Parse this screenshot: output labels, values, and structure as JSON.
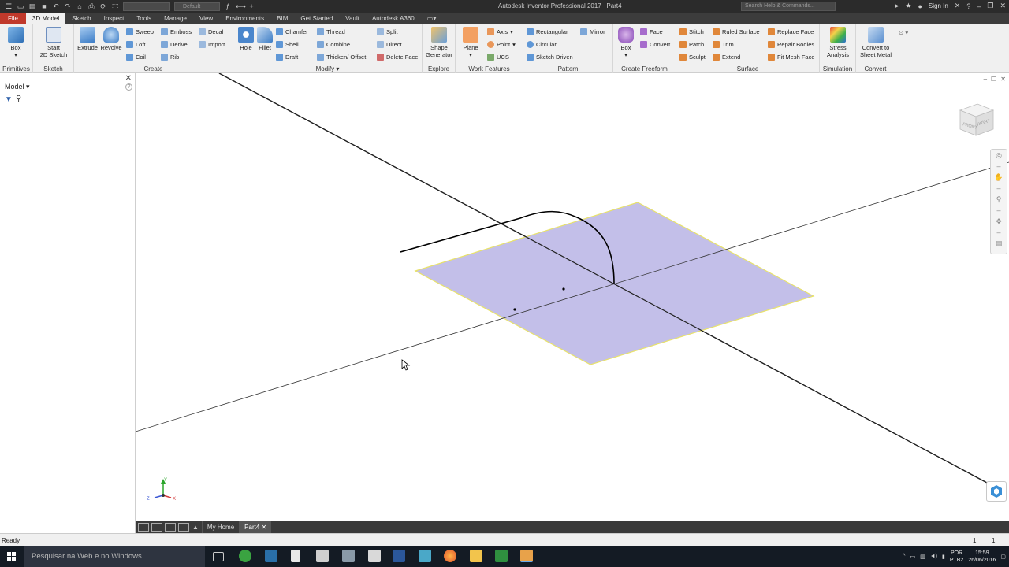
{
  "titlebar": {
    "title": "Autodesk Inventor Professional 2017",
    "doc": "Part4",
    "search_placeholder": "Search Help & Commands...",
    "sign_in": "Sign In",
    "appearance_value": "Default"
  },
  "tabs": [
    "File",
    "3D Model",
    "Sketch",
    "Inspect",
    "Tools",
    "Manage",
    "View",
    "Environments",
    "BIM",
    "Get Started",
    "Vault",
    "Autodesk A360"
  ],
  "ribbon": {
    "primitives": {
      "label": "Primitives",
      "box": "Box"
    },
    "sketch": {
      "label": "Sketch",
      "start": "Start",
      "start2": "2D Sketch"
    },
    "create": {
      "label": "Create",
      "extrude": "Extrude",
      "revolve": "Revolve",
      "sweep": "Sweep",
      "loft": "Loft",
      "coil": "Coil",
      "emboss": "Emboss",
      "derive": "Derive",
      "rib": "Rib",
      "decal": "Decal",
      "import": "Import"
    },
    "modify": {
      "label": "Modify",
      "hole": "Hole",
      "fillet": "Fillet",
      "chamfer": "Chamfer",
      "shell": "Shell",
      "draft": "Draft",
      "thread": "Thread",
      "combine": "Combine",
      "thicken": "Thicken/ Offset",
      "split": "Split",
      "direct": "Direct",
      "delete_face": "Delete Face"
    },
    "explore": {
      "label": "Explore",
      "shape1": "Shape",
      "shape2": "Generator"
    },
    "work": {
      "label": "Work Features",
      "plane": "Plane",
      "axis": "Axis",
      "point": "Point",
      "ucs": "UCS"
    },
    "pattern": {
      "label": "Pattern",
      "rect": "Rectangular",
      "circ": "Circular",
      "sketch_driven": "Sketch Driven",
      "mirror": "Mirror"
    },
    "freeform": {
      "label": "Create Freeform",
      "box": "Box",
      "face": "Face",
      "convert": "Convert"
    },
    "surface": {
      "label": "Surface",
      "stitch": "Stitch",
      "patch": "Patch",
      "sculpt": "Sculpt",
      "ruled": "Ruled Surface",
      "trim": "Trim",
      "extend": "Extend",
      "replace": "Replace Face",
      "repair": "Repair Bodies",
      "fitmesh": "Fit Mesh Face"
    },
    "simulation": {
      "label": "Simulation",
      "stress1": "Stress",
      "stress2": "Analysis"
    },
    "convert": {
      "label": "Convert",
      "c1": "Convert to",
      "c2": "Sheet Metal"
    }
  },
  "browser": {
    "title": "Model"
  },
  "viewcube": {
    "front": "FRONT",
    "right": "RIGHT"
  },
  "triad": {
    "x": "X",
    "y": "Y",
    "z": "Z"
  },
  "doc_tabs": [
    "My Home",
    "Part4"
  ],
  "status": {
    "text": "Ready",
    "n1": "1",
    "n2": "1"
  },
  "taskbar": {
    "search": "Pesquisar na Web e no Windows",
    "lang1": "POR",
    "lang2": "PTB2",
    "time": "15:59",
    "date": "26/06/2016"
  },
  "colors": {
    "plane_fill": "#c3bfe9",
    "plane_edge": "#e8e26a",
    "file_tab": "#c0392b"
  }
}
